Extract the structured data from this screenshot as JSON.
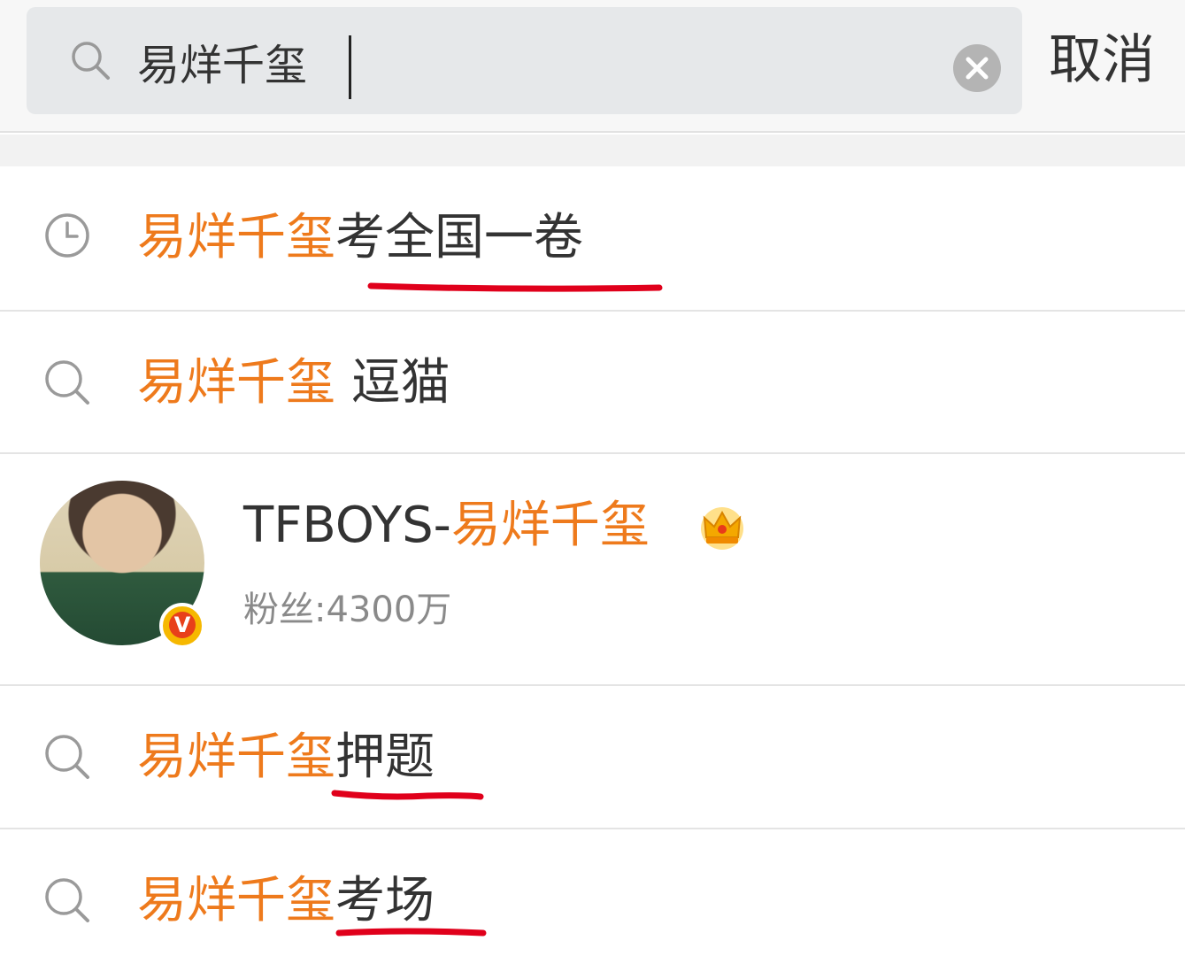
{
  "search": {
    "query": "易烊千玺",
    "cancel_label": "取消"
  },
  "suggestions": [
    {
      "type": "history",
      "icon": "clock-icon",
      "highlight": "易烊千玺",
      "rest": "考全国一卷",
      "underlined": true
    },
    {
      "type": "search",
      "icon": "search-icon",
      "highlight": "易烊千玺",
      "rest": " 逗猫",
      "underlined": false
    },
    {
      "type": "search",
      "icon": "search-icon",
      "highlight": "易烊千玺",
      "rest": "押题",
      "underlined": true
    },
    {
      "type": "search",
      "icon": "search-icon",
      "highlight": "易烊千玺",
      "rest": "考场",
      "underlined": true
    }
  ],
  "user": {
    "name_prefix": "TFBOYS-",
    "name_highlight": "易烊千玺",
    "followers": "粉丝:4300万",
    "badge_letter": "V",
    "badge_icon": "crown-icon"
  },
  "colors": {
    "highlight": "#ee7a1c",
    "text": "#333333",
    "annotation_underline": "#e0001b"
  }
}
